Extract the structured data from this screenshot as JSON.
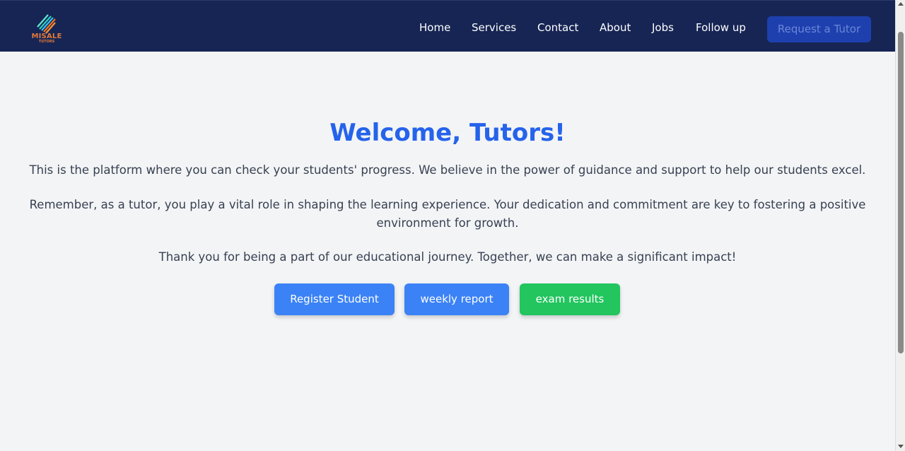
{
  "colors": {
    "navbar_bg": "#172554",
    "page_bg": "#f3f4f6",
    "title": "#2563eb",
    "body_text": "#374151",
    "blue_button": "#3b82f6",
    "green_button": "#22c55e",
    "request_button_bg": "#1e40af",
    "logo_accent": "#e07a3a"
  },
  "header": {
    "logo": {
      "icon": "striped-logo-icon",
      "name": "MISALE",
      "sub": "TUTORS"
    },
    "nav": [
      {
        "label": "Home"
      },
      {
        "label": "Services"
      },
      {
        "label": "Contact"
      },
      {
        "label": "About"
      },
      {
        "label": "Jobs"
      },
      {
        "label": "Follow up"
      }
    ],
    "request_button": "Request a Tutor"
  },
  "main": {
    "title": "Welcome, Tutors!",
    "paragraphs": [
      "This is the platform where you can check your students' progress. We believe in the power of guidance and support to help our students excel.",
      "Remember, as a tutor, you play a vital role in shaping the learning experience. Your dedication and commitment are key to fostering a positive environment for growth.",
      "Thank you for being a part of our educational journey. Together, we can make a significant impact!"
    ],
    "buttons": {
      "register": "Register Student",
      "weekly": "weekly report",
      "exam": "exam results"
    }
  }
}
